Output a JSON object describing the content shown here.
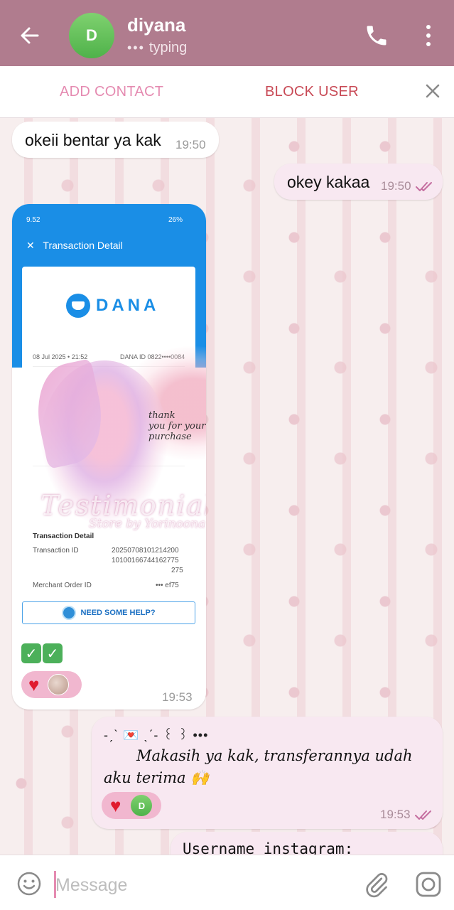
{
  "header": {
    "avatar_letter": "D",
    "contact_name": "diyana",
    "status_dots": "•••",
    "status_text": "typing"
  },
  "action_bar": {
    "add_contact_label": "ADD CONTACT",
    "block_user_label": "BLOCK USER"
  },
  "messages": [
    {
      "direction": "in",
      "text": "okeii bentar ya kak",
      "time": "19:50"
    },
    {
      "direction": "out",
      "text": "okey kakaa",
      "time": "19:50",
      "read": true
    },
    {
      "direction": "in",
      "type": "image",
      "time": "19:53",
      "emoji_text": "✅✅",
      "reaction": "❤️",
      "image": {
        "status_time": "9.52",
        "battery": "26%",
        "title": "Transaction Detail",
        "brand": "DANA",
        "date": "08 Jul 2025 • 21:52",
        "dana_id": "DANA ID 0822••••0084",
        "section_heading": "Transaction Detail",
        "transaction_id_label": "Transaction ID",
        "transaction_id_value": [
          "20250708101214200",
          "10100166744162775",
          "275"
        ],
        "merchant_order_label": "Merchant Order ID",
        "merchant_order_value": "••• ef75",
        "help_label": "NEED SOME HELP?",
        "watermark_line1": "thank",
        "watermark_line2": "you for your purchase",
        "watermark_title": "Testimonials",
        "watermark_store": "Store by Yorinoona"
      }
    },
    {
      "direction": "out",
      "deco": "-ˏˋ 💌 ˎˊ- ꒰ ꒱ •••",
      "text": "Makasih ya kak, transferannya udah aku terima 🙌",
      "reaction": "❤️",
      "reaction_avatar_letter": "D",
      "time": "19:53",
      "read": true
    },
    {
      "direction": "out",
      "text": "Username instagram:"
    }
  ],
  "composer": {
    "placeholder": "Message"
  },
  "colors": {
    "header_bg": "#b07c8e",
    "accent_pink": "#e58bb1",
    "block_red": "#c84a56",
    "outgoing_bubble": "#f8e8f1",
    "check_color": "#c56fa0"
  }
}
